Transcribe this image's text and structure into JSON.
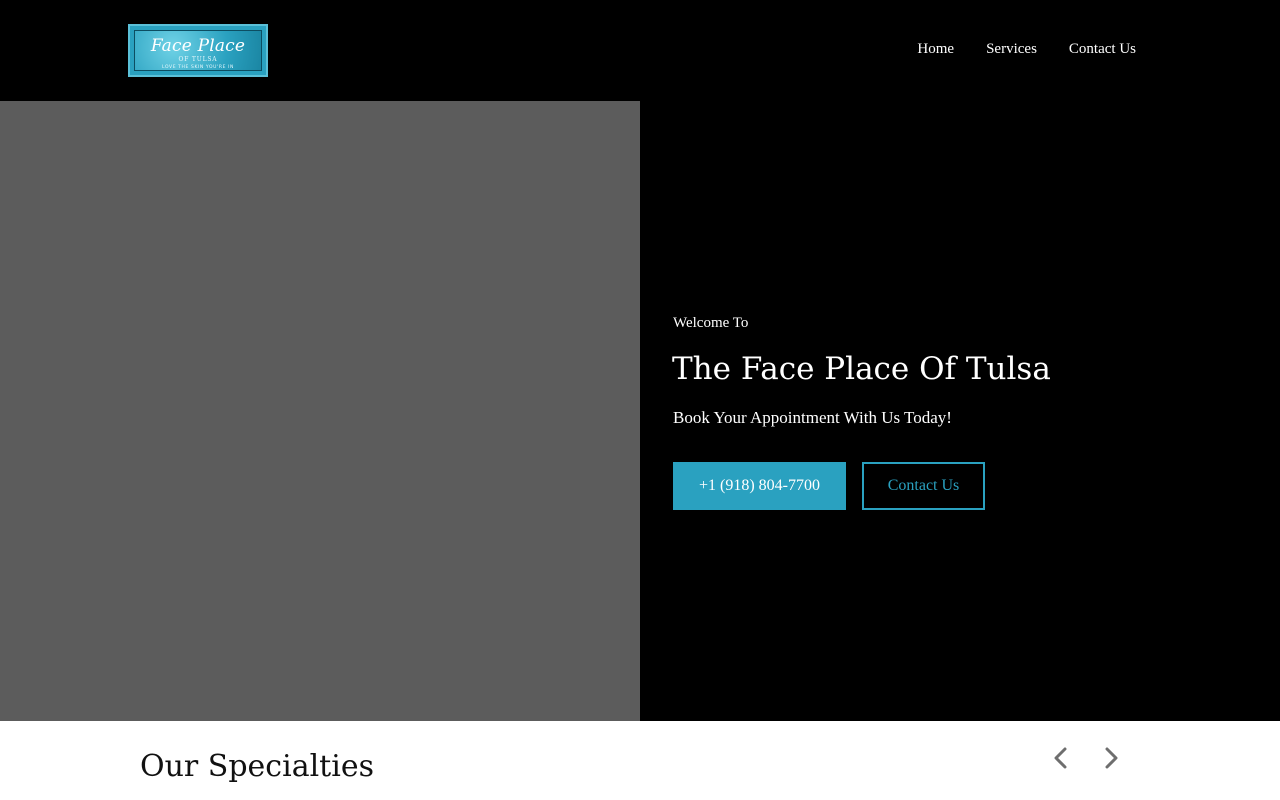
{
  "header": {
    "logo": {
      "title": "Face Place",
      "subtitle": "OF TULSA",
      "tagline": "LOVE THE SKIN YOU'RE IN"
    },
    "nav": [
      {
        "label": "Home"
      },
      {
        "label": "Services"
      },
      {
        "label": "Contact Us"
      }
    ]
  },
  "hero": {
    "welcome": "Welcome To",
    "title": "The Face Place Of Tulsa",
    "subtitle": "Book Your Appointment With Us Today!",
    "phone_button": "+1 (918) 804-7700",
    "contact_button": "Contact Us"
  },
  "specialties": {
    "title": "Our Specialties",
    "prev_icon": "chevron-left-icon",
    "next_icon": "chevron-right-icon"
  },
  "colors": {
    "accent": "#2aa1c0",
    "header_bg": "#000000",
    "image_placeholder": "#5c5c5c"
  }
}
